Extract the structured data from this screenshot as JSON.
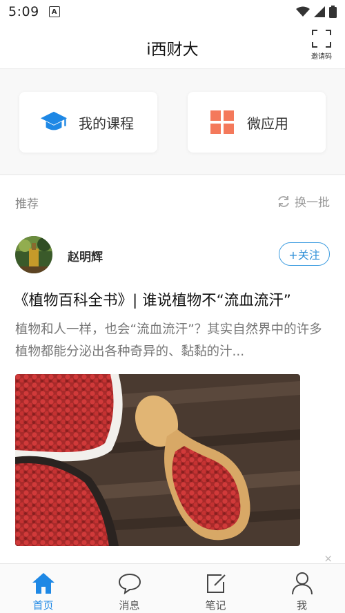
{
  "status_bar": {
    "time": "5:09",
    "notification_icon": "a-box-icon",
    "icons": [
      "wifi-icon",
      "signal-icon",
      "battery-icon"
    ]
  },
  "header": {
    "title": "i西财大",
    "invite_label": "邀请码",
    "invite_icon": "scan-frame-icon"
  },
  "quick_actions": [
    {
      "label": "我的课程",
      "icon": "graduation-cap-icon",
      "color": "#1e88e5"
    },
    {
      "label": "微应用",
      "icon": "grid-icon",
      "color": "#f4795b"
    }
  ],
  "recommend": {
    "title": "推荐",
    "refresh_label": "换一批"
  },
  "post": {
    "author": "赵明辉",
    "follow_label": "+关注",
    "title": "《植物百科全书》| 谁说植物不“流血流汗”",
    "summary": "植物和人一样，也会“流血流汗”？其实自然界中的许多植物都能分泌出各种奇异的、黏黏的汁..."
  },
  "close_label": "×",
  "tabs": [
    {
      "label": "首页",
      "icon": "home-icon",
      "active": true
    },
    {
      "label": "消息",
      "icon": "chat-bubble-icon",
      "active": false
    },
    {
      "label": "笔记",
      "icon": "note-edit-icon",
      "active": false
    },
    {
      "label": "我",
      "icon": "person-icon",
      "active": false
    }
  ],
  "colors": {
    "accent": "#1e88e5",
    "follow": "#2f8fd8",
    "micro_app": "#f4795b"
  }
}
